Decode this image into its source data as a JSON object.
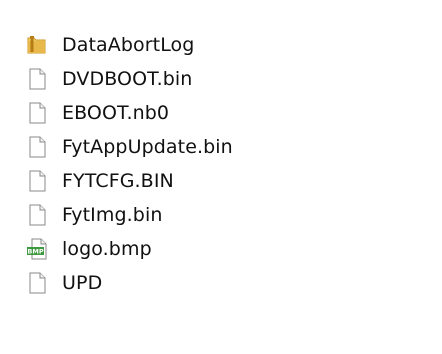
{
  "files": [
    {
      "name": "DataAbortLog",
      "icon": "folder-icon"
    },
    {
      "name": "DVDBOOT.bin",
      "icon": "file-icon"
    },
    {
      "name": "EBOOT.nb0",
      "icon": "file-icon"
    },
    {
      "name": "FytAppUpdate.bin",
      "icon": "file-icon"
    },
    {
      "name": "FYTCFG.BIN",
      "icon": "file-icon"
    },
    {
      "name": "FytImg.bin",
      "icon": "file-icon"
    },
    {
      "name": "logo.bmp",
      "icon": "bmp-file-icon",
      "badge": "BMP"
    },
    {
      "name": "UPD",
      "icon": "file-icon"
    }
  ],
  "colors": {
    "folder": "#e8b84a",
    "file_border": "#8a8a8a",
    "bmp_badge": "#3f9a3f"
  }
}
